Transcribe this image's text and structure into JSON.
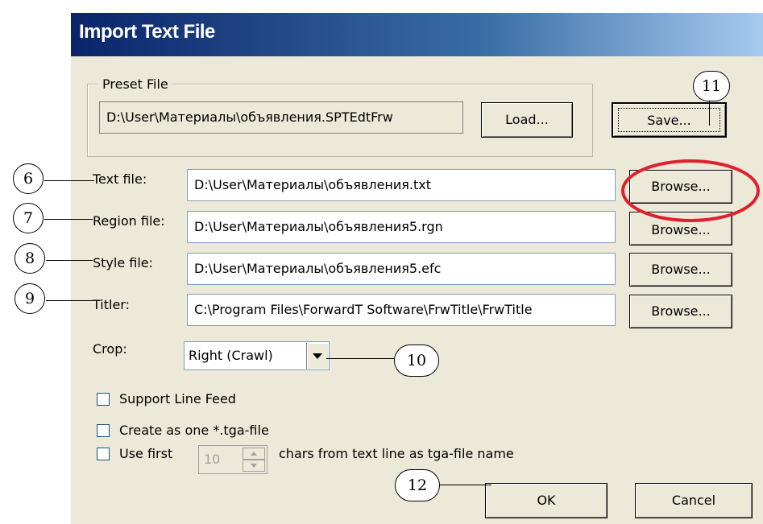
{
  "dialog": {
    "title": "Import Text File",
    "preset": {
      "legend": "Preset File",
      "path": "D:\\User\\Материалы\\объявления.SPTEdtFrw",
      "load_label": "Load...",
      "save_label": "Save..."
    },
    "files": [
      {
        "label": "Text file:",
        "value": "D:\\User\\Материалы\\объявления.txt",
        "browse_label": "Browse..."
      },
      {
        "label": "Region file:",
        "value": "D:\\User\\Материалы\\объявления5.rgn",
        "browse_label": "Browse..."
      },
      {
        "label": "Style file:",
        "value": "D:\\User\\Материалы\\объявления5.efc",
        "browse_label": "Browse..."
      },
      {
        "label": "Titler:",
        "value": "C:\\Program Files\\ForwardT Software\\FrwTitle\\FrwTitle",
        "browse_label": "Browse..."
      }
    ],
    "crop": {
      "label": "Crop:",
      "selected": "Right (Crawl)"
    },
    "options": {
      "line_feed": {
        "label": "Support Line Feed",
        "checked": false
      },
      "one_tga": {
        "label": "Create as one *.tga-file",
        "checked": false
      },
      "use_first": {
        "label": "Use first",
        "value": "10",
        "suffix": "chars from text line as tga-file name",
        "checked": false
      }
    },
    "ok_label": "OK",
    "cancel_label": "Cancel"
  },
  "callouts": {
    "c6": "6",
    "c7": "7",
    "c8": "8",
    "c9": "9",
    "c10": "10",
    "c11": "11",
    "c12": "12"
  },
  "highlight_color": "#e0202c"
}
